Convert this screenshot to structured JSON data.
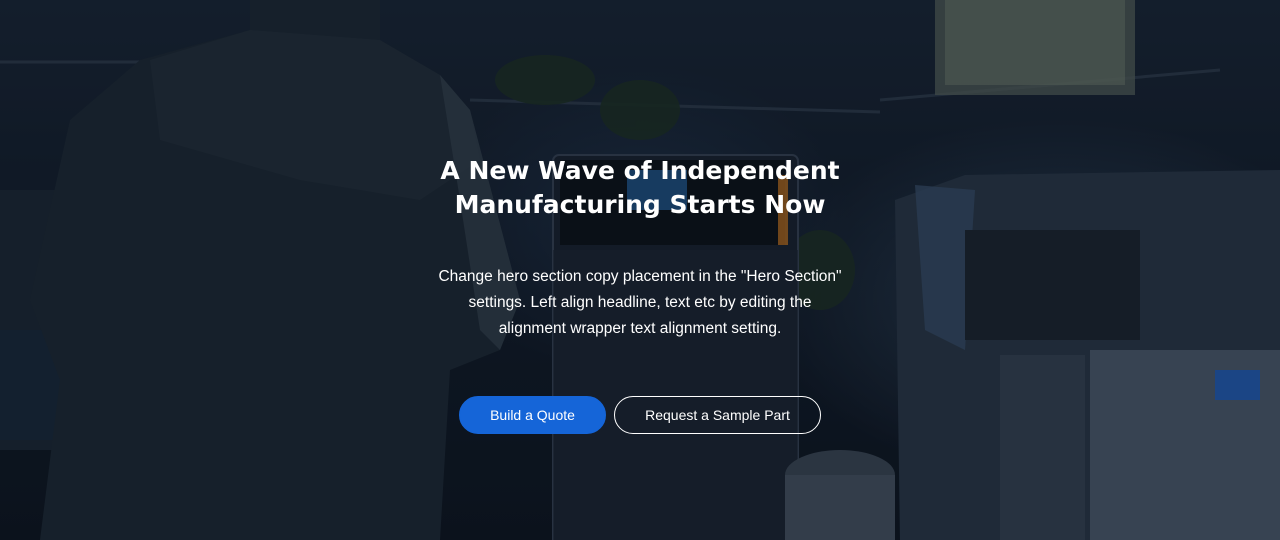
{
  "hero": {
    "headline": "A New Wave of Independent Manufacturing Starts Now",
    "body": "Change hero section copy placement in the \"Hero Section\" settings. Left align headline, text etc by editing the alignment wrapper text alignment setting.",
    "background": "video-still-person-with-3d-printers"
  },
  "buttons": {
    "primary_label": "Build a Quote",
    "secondary_label": "Request a Sample Part"
  },
  "colors": {
    "accent": "#1565d8",
    "text": "#ffffff",
    "background": "#121d2b"
  }
}
